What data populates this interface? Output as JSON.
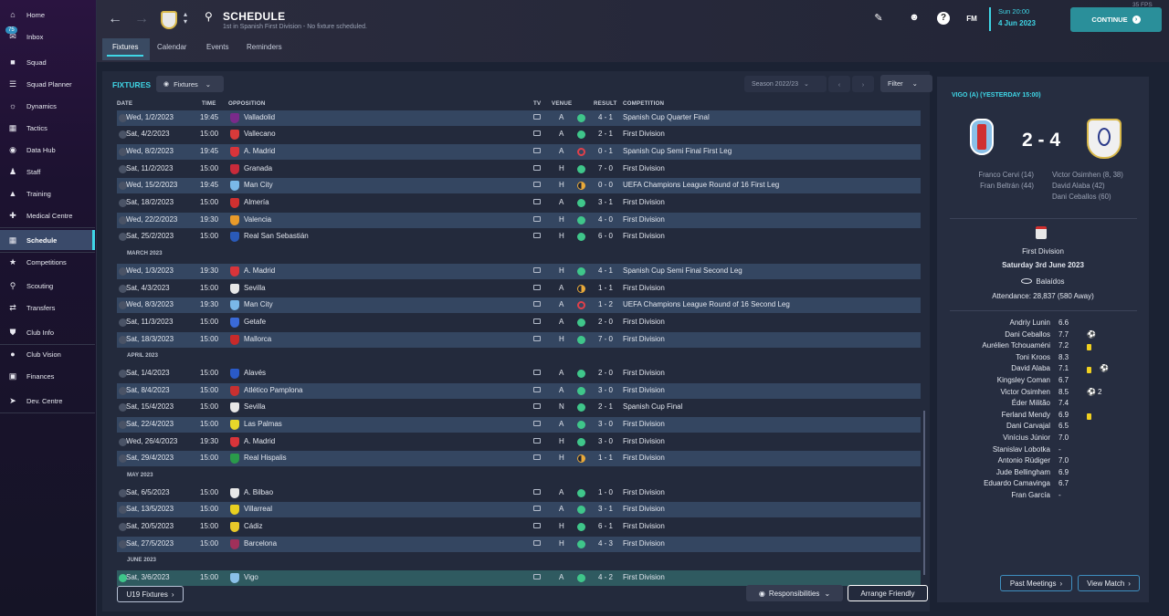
{
  "fps": "35 FPS",
  "sidebar": {
    "items": [
      {
        "label": "Home",
        "icon": "home-icon"
      },
      {
        "label": "Inbox",
        "icon": "inbox-icon",
        "badge": "75"
      },
      {
        "label": "Squad",
        "icon": "shirt-icon"
      },
      {
        "label": "Squad Planner",
        "icon": "planner-icon"
      },
      {
        "label": "Dynamics",
        "icon": "dynamics-icon"
      },
      {
        "label": "Tactics",
        "icon": "tactics-icon"
      },
      {
        "label": "Data Hub",
        "icon": "data-hub-icon"
      },
      {
        "label": "Staff",
        "icon": "staff-icon"
      },
      {
        "label": "Training",
        "icon": "training-icon"
      },
      {
        "label": "Medical Centre",
        "icon": "medical-icon"
      },
      {
        "label": "Schedule",
        "icon": "calendar-icon",
        "active": true
      },
      {
        "label": "Competitions",
        "icon": "trophy-icon"
      },
      {
        "label": "Scouting",
        "icon": "scouting-icon"
      },
      {
        "label": "Transfers",
        "icon": "transfers-icon"
      },
      {
        "label": "Club Info",
        "icon": "shield-icon"
      },
      {
        "label": "Club Vision",
        "icon": "vision-icon"
      },
      {
        "label": "Finances",
        "icon": "finances-icon"
      },
      {
        "label": "Dev. Centre",
        "icon": "dev-centre-icon"
      }
    ]
  },
  "header": {
    "title": "SCHEDULE",
    "subtitle": "1st in Spanish First Division - No fixture scheduled.",
    "tabs": [
      "Fixtures",
      "Calendar",
      "Events",
      "Reminders"
    ],
    "date_line1": "Sun 20:00",
    "date_line2": "4 Jun 2023",
    "continue_label": "CONTINUE",
    "fm_label": "FM"
  },
  "fixtures": {
    "title": "FIXTURES",
    "view_dropdown": "Fixtures",
    "season_dropdown": "Season 2022/23",
    "filter_label": "Filter",
    "columns": {
      "date": "DATE",
      "time": "TIME",
      "opposition": "OPPOSITION",
      "tv": "TV",
      "venue": "VENUE",
      "result": "RESULT",
      "competition": "COMPETITION"
    },
    "months": {
      "march": "MARCH 2023",
      "april": "APRIL 2023",
      "may": "MAY 2023",
      "june": "JUNE 2023"
    },
    "rows": [
      {
        "date": "Wed, 1/2/2023",
        "time": "19:45",
        "opp": "Valladolid",
        "venue": "A",
        "outcome": "W",
        "result": "4 - 1",
        "comp": "Spanish Cup Quarter Final",
        "crest": "#7a2a8a"
      },
      {
        "date": "Sat, 4/2/2023",
        "time": "15:00",
        "opp": "Vallecano",
        "venue": "A",
        "outcome": "W",
        "result": "2 - 1",
        "comp": "First Division",
        "crest": "#d83a3a"
      },
      {
        "date": "Wed, 8/2/2023",
        "time": "19:45",
        "opp": "A. Madrid",
        "venue": "A",
        "outcome": "L",
        "result": "0 - 1",
        "comp": "Spanish Cup Semi Final First Leg",
        "crest": "#d8343a"
      },
      {
        "date": "Sat, 11/2/2023",
        "time": "15:00",
        "opp": "Granada",
        "venue": "H",
        "outcome": "W",
        "result": "7 - 0",
        "comp": "First Division",
        "crest": "#c82a3a"
      },
      {
        "date": "Wed, 15/2/2023",
        "time": "19:45",
        "opp": "Man City",
        "venue": "H",
        "outcome": "D",
        "result": "0 - 0",
        "comp": "UEFA Champions League Round of 16  First Leg",
        "crest": "#7ab8e8"
      },
      {
        "date": "Sat, 18/2/2023",
        "time": "15:00",
        "opp": "Almería",
        "venue": "A",
        "outcome": "W",
        "result": "3 - 1",
        "comp": "First Division",
        "crest": "#d03030"
      },
      {
        "date": "Wed, 22/2/2023",
        "time": "19:30",
        "opp": "Valencia",
        "venue": "H",
        "outcome": "W",
        "result": "4 - 0",
        "comp": "First Division",
        "crest": "#e89a2a"
      },
      {
        "date": "Sat, 25/2/2023",
        "time": "15:00",
        "opp": "Real San Sebastián",
        "venue": "H",
        "outcome": "W",
        "result": "6 - 0",
        "comp": "First Division",
        "crest": "#2a5ab8"
      },
      {
        "date": "Wed, 1/3/2023",
        "time": "19:30",
        "opp": "A. Madrid",
        "venue": "H",
        "outcome": "W",
        "result": "4 - 1",
        "comp": "Spanish Cup Semi Final Second Leg",
        "crest": "#d8343a"
      },
      {
        "date": "Sat, 4/3/2023",
        "time": "15:00",
        "opp": "Sevilla",
        "venue": "A",
        "outcome": "D",
        "result": "1 - 1",
        "comp": "First Division",
        "crest": "#e8e8e8"
      },
      {
        "date": "Wed, 8/3/2023",
        "time": "19:30",
        "opp": "Man City",
        "venue": "A",
        "outcome": "L",
        "result": "1 - 2",
        "comp": "UEFA Champions League Round of 16  Second Leg",
        "crest": "#7ab8e8"
      },
      {
        "date": "Sat, 11/3/2023",
        "time": "15:00",
        "opp": "Getafe",
        "venue": "A",
        "outcome": "W",
        "result": "2 - 0",
        "comp": "First Division",
        "crest": "#3a6ad8"
      },
      {
        "date": "Sat, 18/3/2023",
        "time": "15:00",
        "opp": "Mallorca",
        "venue": "H",
        "outcome": "W",
        "result": "7 - 0",
        "comp": "First Division",
        "crest": "#c82a2a"
      },
      {
        "date": "Sat, 1/4/2023",
        "time": "15:00",
        "opp": "Alavés",
        "venue": "A",
        "outcome": "W",
        "result": "2 - 0",
        "comp": "First Division",
        "crest": "#2a5ac8"
      },
      {
        "date": "Sat, 8/4/2023",
        "time": "15:00",
        "opp": "Atlético Pamplona",
        "venue": "A",
        "outcome": "W",
        "result": "3 - 0",
        "comp": "First Division",
        "crest": "#c83030"
      },
      {
        "date": "Sat, 15/4/2023",
        "time": "15:00",
        "opp": "Sevilla",
        "venue": "N",
        "outcome": "W",
        "result": "2 - 1",
        "comp": "Spanish Cup Final",
        "crest": "#e8e8e8"
      },
      {
        "date": "Sat, 22/4/2023",
        "time": "15:00",
        "opp": "Las Palmas",
        "venue": "A",
        "outcome": "W",
        "result": "3 - 0",
        "comp": "First Division",
        "crest": "#e8d82a"
      },
      {
        "date": "Wed, 26/4/2023",
        "time": "19:30",
        "opp": "A. Madrid",
        "venue": "H",
        "outcome": "W",
        "result": "3 - 0",
        "comp": "First Division",
        "crest": "#d8343a"
      },
      {
        "date": "Sat, 29/4/2023",
        "time": "15:00",
        "opp": "Real Hispalis",
        "venue": "H",
        "outcome": "D",
        "result": "1 - 1",
        "comp": "First Division",
        "crest": "#2a9a4a"
      },
      {
        "date": "Sat, 6/5/2023",
        "time": "15:00",
        "opp": "A. Bilbao",
        "venue": "A",
        "outcome": "W",
        "result": "1 - 0",
        "comp": "First Division",
        "crest": "#e8e8e8"
      },
      {
        "date": "Sat, 13/5/2023",
        "time": "15:00",
        "opp": "Villarreal",
        "venue": "A",
        "outcome": "W",
        "result": "3 - 1",
        "comp": "First Division",
        "crest": "#e8d020"
      },
      {
        "date": "Sat, 20/5/2023",
        "time": "15:00",
        "opp": "Cádiz",
        "venue": "H",
        "outcome": "W",
        "result": "6 - 1",
        "comp": "First Division",
        "crest": "#e8c82a"
      },
      {
        "date": "Sat, 27/5/2023",
        "time": "15:00",
        "opp": "Barcelona",
        "venue": "H",
        "outcome": "W",
        "result": "4 - 3",
        "comp": "First Division",
        "crest": "#a0305a"
      },
      {
        "date": "Sat, 3/6/2023",
        "time": "15:00",
        "opp": "Vigo",
        "venue": "A",
        "outcome": "W",
        "result": "4 - 2",
        "comp": "First Division",
        "crest": "#8ac0e8"
      }
    ],
    "u19_button": "U19 Fixtures",
    "responsibilities_button": "Responsibilities",
    "arrange_friendly_button": "Arrange Friendly"
  },
  "match": {
    "title": "VIGO (A) (YESTERDAY 15:00)",
    "score": "2 - 4",
    "home_scorers": [
      "Franco Cervi (14)",
      "Fran Beltrán (44)"
    ],
    "away_scorers": [
      "Victor Osimhen (8, 38)",
      "David Alaba (42)",
      "Dani Ceballos (60)"
    ],
    "competition": "First Division",
    "date": "Saturday 3rd June 2023",
    "stadium": "Balaídos",
    "attendance": "Attendance: 28,837 (580 Away)",
    "players": [
      {
        "name": "Andriy Lunin",
        "rating": "6.6"
      },
      {
        "name": "Dani Ceballos",
        "rating": "7.7",
        "goal": ""
      },
      {
        "name": "Aurélien Tchouaméni",
        "rating": "7.2",
        "yellow": true
      },
      {
        "name": "Toni Kroos",
        "rating": "8.3"
      },
      {
        "name": "David Alaba",
        "rating": "7.1",
        "yellow": true,
        "goal": ""
      },
      {
        "name": "Kingsley Coman",
        "rating": "6.7"
      },
      {
        "name": "Victor Osimhen",
        "rating": "8.5",
        "goal": "2"
      },
      {
        "name": "Éder Militão",
        "rating": "7.4"
      },
      {
        "name": "Ferland Mendy",
        "rating": "6.9",
        "yellow": true
      },
      {
        "name": "Dani Carvajal",
        "rating": "6.5"
      },
      {
        "name": "Vinícius Júnior",
        "rating": "7.0"
      },
      {
        "name": "Stanislav Lobotka",
        "rating": "-"
      },
      {
        "name": "Antonio Rüdiger",
        "rating": "7.0"
      },
      {
        "name": "Jude Bellingham",
        "rating": "6.9"
      },
      {
        "name": "Eduardo Camavinga",
        "rating": "6.7"
      },
      {
        "name": "Fran García",
        "rating": "-"
      }
    ],
    "past_meetings_button": "Past Meetings",
    "view_match_button": "View Match"
  }
}
